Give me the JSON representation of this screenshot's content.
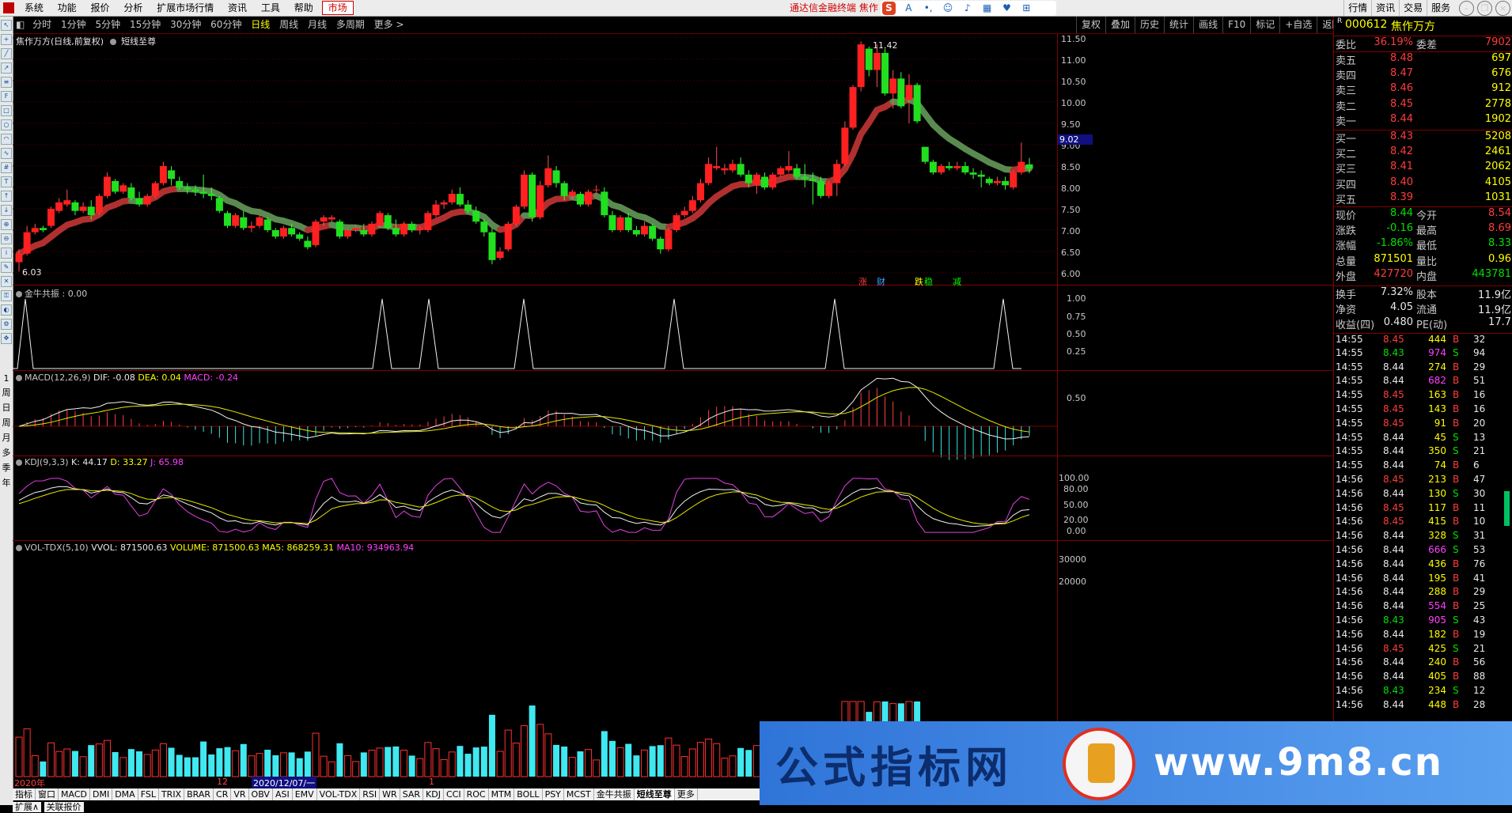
{
  "menubar": {
    "items": [
      "系统",
      "功能",
      "报价",
      "分析",
      "扩展市场行情",
      "资讯",
      "工具",
      "帮助",
      "市场"
    ],
    "promo": "通达信金融终端  焦作",
    "right_items": [
      "行情",
      "资讯",
      "交易",
      "服务"
    ]
  },
  "periods": [
    "分时",
    "1分钟",
    "5分钟",
    "15分钟",
    "30分钟",
    "60分钟",
    "日线",
    "周线",
    "月线",
    "多周期",
    "更多 >"
  ],
  "selected_period": "日线",
  "right_tools": [
    "复权",
    "叠加",
    "历史",
    "统计",
    "画线",
    "F10",
    "标记",
    "+自选",
    "返回"
  ],
  "left_strip_labels": [
    "1",
    "周",
    "日",
    "周",
    "月",
    "多",
    "季",
    "年"
  ],
  "kline": {
    "title": "焦作万方(日线,前复权)",
    "formula": "短线至尊",
    "y_ticks": [
      "11.50",
      "11.00",
      "10.50",
      "10.00",
      "9.50",
      "9.00",
      "8.50",
      "8.00",
      "7.50",
      "7.00",
      "6.50",
      "6.00"
    ],
    "cursor_price": "9.02",
    "high_label": "11.42",
    "low_label": "6.03",
    "markers": [
      "涨",
      "财",
      "跌",
      "稳",
      "减"
    ]
  },
  "jnzz": {
    "title": "金牛共振 : 0.00",
    "y_ticks": [
      "1.00",
      "0.75",
      "0.50",
      "0.25"
    ]
  },
  "macd": {
    "name": "MACD(12,26,9)",
    "dif": "DIF: -0.08",
    "dea": "DEA: 0.04",
    "macd": "MACD: -0.24",
    "y_ticks": [
      "0.50"
    ]
  },
  "kdj": {
    "name": "KDJ(9,3,3)",
    "k": "K: 44.17",
    "d": "D: 33.27",
    "j": "J: 65.98",
    "y_ticks": [
      "100.00",
      "80.00",
      "50.00",
      "20.00",
      "0.00"
    ]
  },
  "vol": {
    "name": "VOL-TDX(5,10)",
    "vvol": "VVOL: 871500.63",
    "volume": "VOLUME: 871500.63",
    "ma5": "MA5: 868259.31",
    "ma10": "MA10: 934963.94",
    "y_ticks": [
      "30000",
      "20000"
    ]
  },
  "xaxis": {
    "labels": [
      "2020年",
      "12",
      "2020/12/07/一",
      "1"
    ]
  },
  "indicator_tabs": [
    "指标",
    "窗口",
    "MACD",
    "DMI",
    "DMA",
    "FSL",
    "TRIX",
    "BRAR",
    "CR",
    "VR",
    "OBV",
    "ASI",
    "EMV",
    "VOL-TDX",
    "RSI",
    "WR",
    "SAR",
    "KDJ",
    "CCI",
    "ROC",
    "MTM",
    "BOLL",
    "PSY",
    "MCST",
    "金牛共振",
    "短线至尊",
    "更多"
  ],
  "bottom_tabs": [
    "扩展∧",
    "关联报价"
  ],
  "quote": {
    "code": "000612",
    "name": "焦作万方",
    "weibi_label": "委比",
    "weibi": "36.19%",
    "weicha_label": "委差",
    "weicha": "7902",
    "asks": [
      {
        "label": "卖五",
        "price": "8.48",
        "vol": "697"
      },
      {
        "label": "卖四",
        "price": "8.47",
        "vol": "676"
      },
      {
        "label": "卖三",
        "price": "8.46",
        "vol": "912"
      },
      {
        "label": "卖二",
        "price": "8.45",
        "vol": "2778"
      },
      {
        "label": "卖一",
        "price": "8.44",
        "vol": "1902"
      }
    ],
    "bids": [
      {
        "label": "买一",
        "price": "8.43",
        "vol": "5208"
      },
      {
        "label": "买二",
        "price": "8.42",
        "vol": "2461"
      },
      {
        "label": "买三",
        "price": "8.41",
        "vol": "2062"
      },
      {
        "label": "买四",
        "price": "8.40",
        "vol": "4105"
      },
      {
        "label": "买五",
        "price": "8.39",
        "vol": "1031"
      }
    ],
    "stats": [
      {
        "l1": "现价",
        "v1": "8.44",
        "c1": "grn",
        "l2": "今开",
        "v2": "8.54",
        "c2": "red"
      },
      {
        "l1": "涨跌",
        "v1": "-0.16",
        "c1": "grn",
        "l2": "最高",
        "v2": "8.69",
        "c2": "red"
      },
      {
        "l1": "涨幅",
        "v1": "-1.86%",
        "c1": "grn",
        "l2": "最低",
        "v2": "8.33",
        "c2": "grn"
      },
      {
        "l1": "总量",
        "v1": "871501",
        "c1": "yel",
        "l2": "量比",
        "v2": "0.96",
        "c2": "yel"
      },
      {
        "l1": "外盘",
        "v1": "427720",
        "c1": "red",
        "l2": "内盘",
        "v2": "443781",
        "c2": "grn"
      }
    ],
    "stats2": [
      {
        "l1": "换手",
        "v1": "7.32%",
        "l2": "股本",
        "v2": "11.9亿"
      },
      {
        "l1": "净资",
        "v1": "4.05",
        "l2": "流通",
        "v2": "11.9亿"
      },
      {
        "l1": "收益(四)",
        "v1": "0.480",
        "l2": "PE(动)",
        "v2": "17.7"
      }
    ],
    "ticks": [
      [
        "14:55",
        "8.45",
        "444",
        "B",
        "32"
      ],
      [
        "14:55",
        "8.43",
        "974",
        "S",
        "94"
      ],
      [
        "14:55",
        "8.44",
        "274",
        "B",
        "29"
      ],
      [
        "14:55",
        "8.44",
        "682",
        "B",
        "51"
      ],
      [
        "14:55",
        "8.45",
        "163",
        "B",
        "16"
      ],
      [
        "14:55",
        "8.45",
        "143",
        "B",
        "16"
      ],
      [
        "14:55",
        "8.45",
        "91",
        "B",
        "20"
      ],
      [
        "14:55",
        "8.44",
        "45",
        "S",
        "13"
      ],
      [
        "14:55",
        "8.44",
        "350",
        "S",
        "21"
      ],
      [
        "14:55",
        "8.44",
        "74",
        "B",
        "6"
      ],
      [
        "14:56",
        "8.45",
        "213",
        "B",
        "47"
      ],
      [
        "14:56",
        "8.44",
        "130",
        "S",
        "30"
      ],
      [
        "14:56",
        "8.45",
        "117",
        "B",
        "11"
      ],
      [
        "14:56",
        "8.45",
        "415",
        "B",
        "10"
      ],
      [
        "14:56",
        "8.44",
        "328",
        "S",
        "31"
      ],
      [
        "14:56",
        "8.44",
        "666",
        "S",
        "53"
      ],
      [
        "14:56",
        "8.44",
        "436",
        "B",
        "76"
      ],
      [
        "14:56",
        "8.44",
        "195",
        "B",
        "41"
      ],
      [
        "14:56",
        "8.44",
        "288",
        "B",
        "29"
      ],
      [
        "14:56",
        "8.44",
        "554",
        "B",
        "25"
      ],
      [
        "14:56",
        "8.43",
        "905",
        "S",
        "43"
      ],
      [
        "14:56",
        "8.44",
        "182",
        "B",
        "19"
      ],
      [
        "14:56",
        "8.45",
        "425",
        "S",
        "21"
      ],
      [
        "14:56",
        "8.44",
        "240",
        "B",
        "56"
      ],
      [
        "14:56",
        "8.44",
        "405",
        "B",
        "88"
      ],
      [
        "14:56",
        "8.43",
        "234",
        "S",
        "12"
      ],
      [
        "14:56",
        "8.44",
        "448",
        "B",
        "28"
      ]
    ]
  },
  "banner": {
    "text_cn": "公式指标网",
    "text_url": "www.9m8.cn"
  },
  "chart_data": {
    "type": "candlestick",
    "title": "焦作万方(日线,前复权)",
    "ylim": [
      6.0,
      11.5
    ],
    "ohlc": [
      [
        6.25,
        6.55,
        6.03,
        6.45
      ],
      [
        6.45,
        7.1,
        6.4,
        6.95
      ],
      [
        6.95,
        7.15,
        6.9,
        7.05
      ],
      [
        7.05,
        7.1,
        6.95,
        7.0
      ],
      [
        7.1,
        7.55,
        7.05,
        7.5
      ],
      [
        7.45,
        7.75,
        7.4,
        7.65
      ],
      [
        7.6,
        7.95,
        7.55,
        7.7
      ],
      [
        7.65,
        7.7,
        7.35,
        7.45
      ],
      [
        7.45,
        7.65,
        7.4,
        7.55
      ],
      [
        7.55,
        7.7,
        7.25,
        7.35
      ],
      [
        7.4,
        7.85,
        7.35,
        7.8
      ],
      [
        7.8,
        8.35,
        7.75,
        8.25
      ],
      [
        8.15,
        8.2,
        7.85,
        7.9
      ],
      [
        7.9,
        8.1,
        7.85,
        8.05
      ],
      [
        8.0,
        8.1,
        7.7,
        7.75
      ],
      [
        7.75,
        7.9,
        7.55,
        7.6
      ],
      [
        7.6,
        7.85,
        7.55,
        7.8
      ],
      [
        7.8,
        8.15,
        7.75,
        8.1
      ],
      [
        8.1,
        8.6,
        8.05,
        8.5
      ],
      [
        8.4,
        8.5,
        8.05,
        8.2
      ],
      [
        8.15,
        8.25,
        7.95,
        8.0
      ],
      [
        8.0,
        8.1,
        7.85,
        7.95
      ],
      [
        7.95,
        8.05,
        7.8,
        7.9
      ],
      [
        7.9,
        8.3,
        7.75,
        7.85
      ],
      [
        7.85,
        8.0,
        7.7,
        7.8
      ],
      [
        7.75,
        7.8,
        7.4,
        7.45
      ],
      [
        7.4,
        7.45,
        7.05,
        7.1
      ],
      [
        7.1,
        7.4,
        7.05,
        7.35
      ],
      [
        7.3,
        7.45,
        7.0,
        7.05
      ],
      [
        7.05,
        7.2,
        6.95,
        7.1
      ],
      [
        7.1,
        7.35,
        7.05,
        7.3
      ],
      [
        7.25,
        7.3,
        6.95,
        7.0
      ],
      [
        7.0,
        7.05,
        6.8,
        6.85
      ],
      [
        6.85,
        7.1,
        6.8,
        7.05
      ],
      [
        7.05,
        7.15,
        6.85,
        6.9
      ],
      [
        6.9,
        6.95,
        6.75,
        6.8
      ],
      [
        6.75,
        6.85,
        6.55,
        6.6
      ],
      [
        6.65,
        7.25,
        6.6,
        7.2
      ],
      [
        7.2,
        7.35,
        7.1,
        7.3
      ],
      [
        7.25,
        7.35,
        7.2,
        7.3
      ],
      [
        7.2,
        7.25,
        6.8,
        6.85
      ],
      [
        6.85,
        7.05,
        6.8,
        7.0
      ],
      [
        7.0,
        7.1,
        6.95,
        7.05
      ],
      [
        7.0,
        7.15,
        6.85,
        6.9
      ],
      [
        6.9,
        7.2,
        6.85,
        7.15
      ],
      [
        7.1,
        7.45,
        7.05,
        7.4
      ],
      [
        7.35,
        7.4,
        7.0,
        7.05
      ],
      [
        7.05,
        7.25,
        6.85,
        6.9
      ],
      [
        6.9,
        7.2,
        6.85,
        7.15
      ],
      [
        7.15,
        7.2,
        6.95,
        7.0
      ],
      [
        7.0,
        7.1,
        6.9,
        7.05
      ],
      [
        7.0,
        7.45,
        6.95,
        7.4
      ],
      [
        7.35,
        7.7,
        7.3,
        7.6
      ],
      [
        7.6,
        7.7,
        7.5,
        7.65
      ],
      [
        7.65,
        7.95,
        7.6,
        7.85
      ],
      [
        7.85,
        8.0,
        7.55,
        7.6
      ],
      [
        7.6,
        7.7,
        7.4,
        7.45
      ],
      [
        7.45,
        7.55,
        7.15,
        7.2
      ],
      [
        7.2,
        7.25,
        6.85,
        6.95
      ],
      [
        6.95,
        7.05,
        6.2,
        6.3
      ],
      [
        6.35,
        6.6,
        6.3,
        6.5
      ],
      [
        6.55,
        7.2,
        6.5,
        7.15
      ],
      [
        7.15,
        7.6,
        7.1,
        7.55
      ],
      [
        7.55,
        8.4,
        7.5,
        8.3
      ],
      [
        8.3,
        8.35,
        7.2,
        7.3
      ],
      [
        7.3,
        8.15,
        7.25,
        8.05
      ],
      [
        8.05,
        8.75,
        8.0,
        8.45
      ],
      [
        8.4,
        8.5,
        8.0,
        8.1
      ],
      [
        8.1,
        8.15,
        7.7,
        7.8
      ],
      [
        7.8,
        7.95,
        7.7,
        7.9
      ],
      [
        7.85,
        7.9,
        7.55,
        7.6
      ],
      [
        7.6,
        7.95,
        7.55,
        7.9
      ],
      [
        7.95,
        8.05,
        7.85,
        7.95
      ],
      [
        7.9,
        8.0,
        7.3,
        7.35
      ],
      [
        7.35,
        7.45,
        6.95,
        7.0
      ],
      [
        7.0,
        7.35,
        6.95,
        7.3
      ],
      [
        7.3,
        7.4,
        6.95,
        7.0
      ],
      [
        7.0,
        7.1,
        6.85,
        6.9
      ],
      [
        6.9,
        7.2,
        6.85,
        7.1
      ],
      [
        7.1,
        7.15,
        6.75,
        6.8
      ],
      [
        6.8,
        6.85,
        6.45,
        6.55
      ],
      [
        6.55,
        7.05,
        6.5,
        7.0
      ],
      [
        7.0,
        7.4,
        6.95,
        7.35
      ],
      [
        7.35,
        7.55,
        7.3,
        7.45
      ],
      [
        7.45,
        7.8,
        7.4,
        7.7
      ],
      [
        7.7,
        8.2,
        7.65,
        8.1
      ],
      [
        8.1,
        8.7,
        8.05,
        8.55
      ],
      [
        8.45,
        8.95,
        8.4,
        8.5
      ],
      [
        8.4,
        8.55,
        8.3,
        8.45
      ],
      [
        8.4,
        8.65,
        8.35,
        8.55
      ],
      [
        8.55,
        8.7,
        8.25,
        8.3
      ],
      [
        8.3,
        8.4,
        8.0,
        8.1
      ],
      [
        8.05,
        8.35,
        7.85,
        8.3
      ],
      [
        8.25,
        8.35,
        7.95,
        8.0
      ],
      [
        8.0,
        8.35,
        7.95,
        8.3
      ],
      [
        8.3,
        8.5,
        8.25,
        8.45
      ],
      [
        8.4,
        8.85,
        8.35,
        8.5
      ],
      [
        8.45,
        8.55,
        8.2,
        8.25
      ],
      [
        8.25,
        8.55,
        8.0,
        8.2
      ],
      [
        8.2,
        8.35,
        7.6,
        8.15
      ],
      [
        8.15,
        8.25,
        7.75,
        7.8
      ],
      [
        7.8,
        8.15,
        7.75,
        8.1
      ],
      [
        8.1,
        8.65,
        7.8,
        8.55
      ],
      [
        8.55,
        9.55,
        8.5,
        9.4
      ],
      [
        9.4,
        10.4,
        9.35,
        10.35
      ],
      [
        10.35,
        11.42,
        10.25,
        11.35
      ],
      [
        11.25,
        11.3,
        10.6,
        10.75
      ],
      [
        10.75,
        11.35,
        10.35,
        11.15
      ],
      [
        11.15,
        11.25,
        10.15,
        10.2
      ],
      [
        10.2,
        10.75,
        9.85,
        10.55
      ],
      [
        10.55,
        10.7,
        9.85,
        9.9
      ],
      [
        10.05,
        10.65,
        9.5,
        10.4
      ],
      [
        10.4,
        10.45,
        9.5,
        9.55
      ],
      [
        8.95,
        8.95,
        8.55,
        8.6
      ],
      [
        8.6,
        8.65,
        8.3,
        8.35
      ],
      [
        8.35,
        8.55,
        8.3,
        8.5
      ],
      [
        8.5,
        8.6,
        8.4,
        8.45
      ],
      [
        8.45,
        8.6,
        8.4,
        8.5
      ],
      [
        8.5,
        8.6,
        8.3,
        8.35
      ],
      [
        8.35,
        8.45,
        8.2,
        8.3
      ],
      [
        8.3,
        8.4,
        8.0,
        8.25
      ],
      [
        8.2,
        8.25,
        8.05,
        8.1
      ],
      [
        8.1,
        8.25,
        8.05,
        8.15
      ],
      [
        8.15,
        8.25,
        7.95,
        8.05
      ],
      [
        8.0,
        8.4,
        7.95,
        8.35
      ],
      [
        8.35,
        9.05,
        8.3,
        8.6
      ],
      [
        8.54,
        8.69,
        8.33,
        8.44
      ]
    ]
  }
}
